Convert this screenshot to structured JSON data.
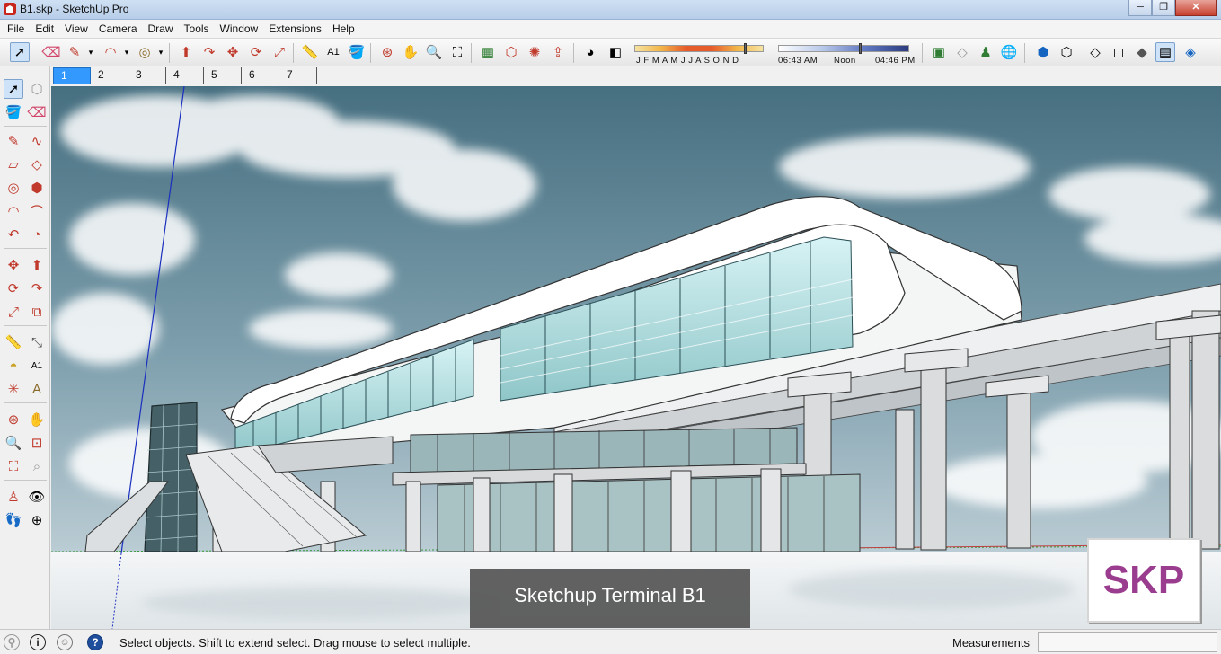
{
  "window": {
    "title": "B1.skp - SketchUp Pro",
    "buttons": {
      "minimize": "─",
      "maximize": "❐",
      "close": "✕"
    }
  },
  "menu": [
    "File",
    "Edit",
    "View",
    "Camera",
    "Draw",
    "Tools",
    "Window",
    "Extensions",
    "Help"
  ],
  "toolbar": {
    "shadow_months": "J F M A M J J A S O N D",
    "shadow_time_start": "06:43 AM",
    "shadow_time_mid": "Noon",
    "shadow_time_end": "04:46 PM"
  },
  "scenes": [
    "1",
    "2",
    "3",
    "4",
    "5",
    "6",
    "7"
  ],
  "active_scene": "1",
  "viewport": {
    "caption": "Sketchup Terminal B1",
    "logo_text": "SKP"
  },
  "status": {
    "message": "Select objects. Shift to extend select. Drag mouse to select multiple.",
    "measurements_label": "Measurements",
    "measurements_value": ""
  },
  "icons": {
    "geo": "ⓘ",
    "info": "ⓘ",
    "help": "?"
  },
  "colors": {
    "selected_tab": "#3399ff",
    "logo": "#9b3d8f",
    "sky": "#5f8595"
  }
}
